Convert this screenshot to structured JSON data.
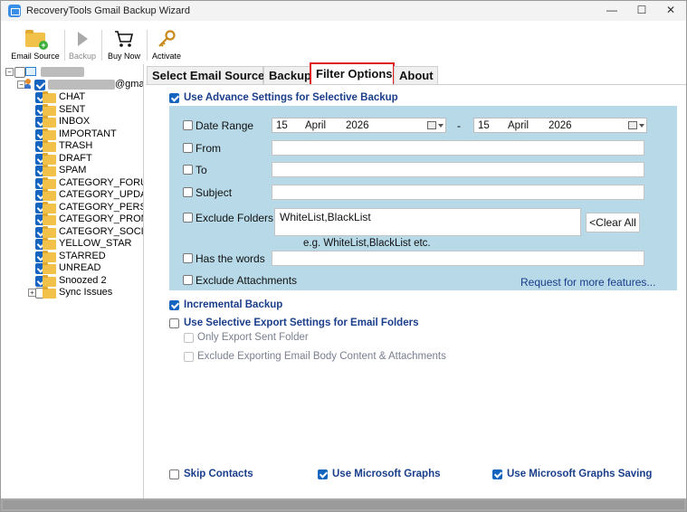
{
  "window": {
    "title": "RecoveryTools Gmail Backup Wizard",
    "min_glyph": "—",
    "max_glyph": "☐",
    "close_glyph": "✕"
  },
  "toolbar": {
    "email_source": "Email Source",
    "backup": "Backup",
    "buy_now": "Buy Now",
    "activate": "Activate"
  },
  "tree": {
    "account_suffix": "@gmail.com",
    "folders": [
      {
        "label": "CHAT",
        "checked": true
      },
      {
        "label": "SENT",
        "checked": true
      },
      {
        "label": "INBOX",
        "checked": true
      },
      {
        "label": "IMPORTANT",
        "checked": true
      },
      {
        "label": "TRASH",
        "checked": true
      },
      {
        "label": "DRAFT",
        "checked": true
      },
      {
        "label": "SPAM",
        "checked": true
      },
      {
        "label": "CATEGORY_FORUM",
        "checked": true
      },
      {
        "label": "CATEGORY_UPDAT",
        "checked": true
      },
      {
        "label": "CATEGORY_PERSO",
        "checked": true
      },
      {
        "label": "CATEGORY_PROMO",
        "checked": true
      },
      {
        "label": "CATEGORY_SOCIAL",
        "checked": true
      },
      {
        "label": "YELLOW_STAR",
        "checked": true
      },
      {
        "label": "STARRED",
        "checked": true
      },
      {
        "label": "UNREAD",
        "checked": true
      },
      {
        "label": "Snoozed 2",
        "checked": true
      },
      {
        "label": "Sync Issues",
        "checked": false
      }
    ]
  },
  "tabs": [
    {
      "label": "Select Email Source",
      "active": false
    },
    {
      "label": "Backup",
      "active": false
    },
    {
      "label": "Filter Options",
      "active": true
    },
    {
      "label": "About",
      "active": false
    }
  ],
  "filter": {
    "use_advance": "Use Advance Settings for Selective Backup",
    "date_range": "Date Range",
    "date_from": {
      "day": "15",
      "month": "April",
      "year": "2026"
    },
    "date_to": {
      "day": "15",
      "month": "April",
      "year": "2026"
    },
    "date_dash": "-",
    "from": "From",
    "to": "To",
    "subject": "Subject",
    "exclude_folders": "Exclude Folders",
    "exclude_folders_value": "WhiteList,BlackList",
    "clear_all": "<Clear All",
    "example_hint": "e.g. WhiteList,BlackList etc.",
    "has_words": "Has the words",
    "exclude_attachments": "Exclude Attachments",
    "request_link": "Request for more features..."
  },
  "options": {
    "incremental_backup": "Incremental Backup",
    "selective_export": "Use Selective Export Settings for Email Folders",
    "only_sent": "Only Export Sent Folder",
    "exclude_body": "Exclude Exporting Email Body Content & Attachments",
    "skip_contacts": "Skip Contacts",
    "ms_graphs": "Use Microsoft Graphs",
    "ms_graphs_saving": "Use Microsoft Graphs Saving"
  },
  "colors": {
    "accent": "#1565c0",
    "filter_panel": "#b7d9e8",
    "label_blue": "#1a3e8a",
    "tab_highlight": "#e02020"
  }
}
